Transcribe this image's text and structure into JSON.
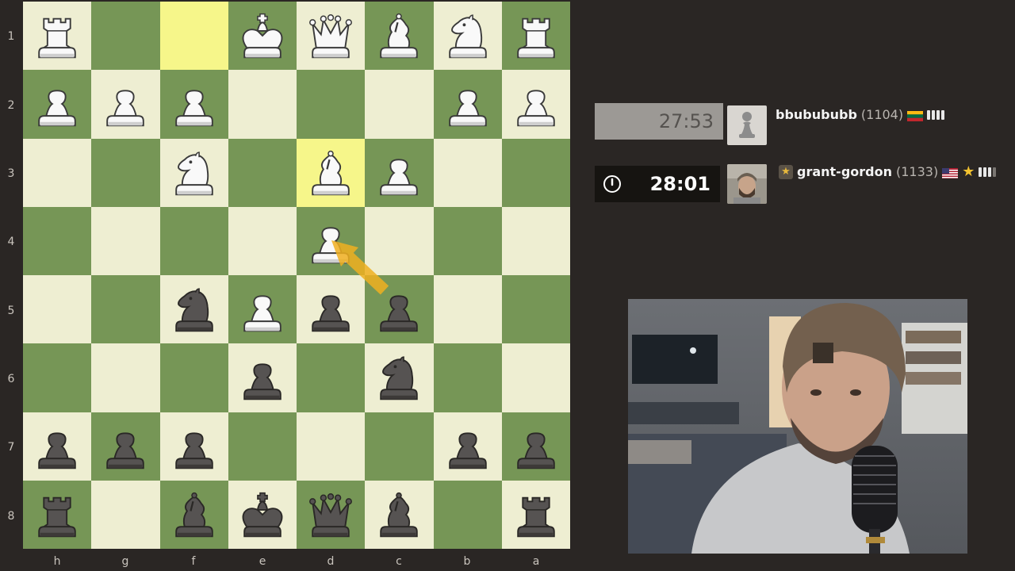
{
  "board": {
    "ranks": [
      "1",
      "2",
      "3",
      "4",
      "5",
      "6",
      "7",
      "8"
    ],
    "files": [
      "h",
      "g",
      "f",
      "e",
      "d",
      "c",
      "b",
      "a"
    ],
    "highlighted_squares": [
      "f1",
      "d3"
    ],
    "last_move_arrow": {
      "from": "c5",
      "to": "d4"
    },
    "colors": {
      "light": "#eeeed2",
      "dark": "#769656",
      "highlight": "#f6f68a",
      "arrow": "#f0b020"
    },
    "rows": [
      [
        "wR",
        "",
        "",
        "wK",
        "wQ",
        "wB",
        "wN",
        "wR"
      ],
      [
        "wP",
        "wP",
        "wP",
        "",
        "",
        "",
        "wP",
        "wP"
      ],
      [
        "",
        "",
        "wN",
        "",
        "wB",
        "wP",
        "",
        ""
      ],
      [
        "",
        "",
        "",
        "",
        "wP",
        "",
        "",
        ""
      ],
      [
        "",
        "",
        "bN",
        "wP",
        "bP",
        "bP",
        "",
        ""
      ],
      [
        "",
        "",
        "",
        "bP",
        "",
        "bN",
        "",
        ""
      ],
      [
        "bP",
        "bP",
        "bP",
        "",
        "",
        "",
        "bP",
        "bP"
      ],
      [
        "bR",
        "",
        "bB",
        "bK",
        "bQ",
        "bB",
        "",
        "bR"
      ]
    ]
  },
  "opponent": {
    "clock": "27:53",
    "username": "bbubububb",
    "rating": "(1104)",
    "flag": "lithuania-flag",
    "avatar": "pawn-avatar-icon"
  },
  "player": {
    "clock": "28:01",
    "username": "grant-gordon",
    "rating": "(1133)",
    "flag": "usa-flag",
    "avatar": "streamer-photo",
    "timer_icon": "clock-icon"
  },
  "webcam": {
    "label": "streamer webcam"
  }
}
